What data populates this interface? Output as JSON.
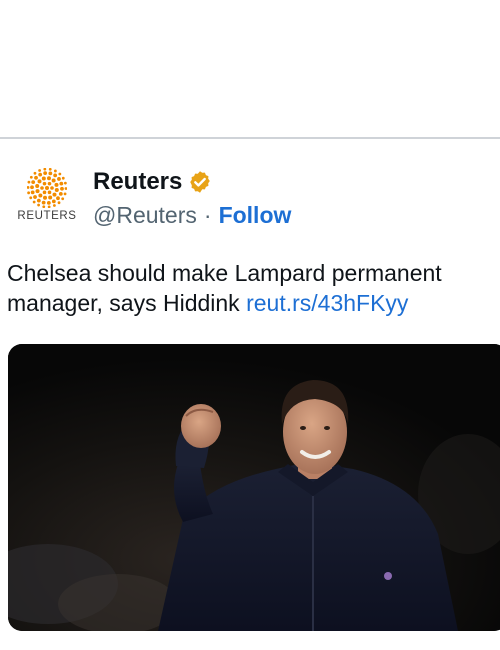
{
  "author": {
    "logo_wordmark": "REUTERS",
    "display_name": "Reuters",
    "handle": "@Reuters",
    "separator": "·",
    "follow_label": "Follow",
    "verified_badge_color": "#e8a317"
  },
  "tweet": {
    "text": "Chelsea should make Lampard permanent manager, says Hiddink",
    "link": "reut.rs/43hFKyy"
  },
  "media": {
    "description_icon": "photo-of-man-raising-fist"
  },
  "colors": {
    "link_blue": "#1d6fd4",
    "text_dark": "#0f1419",
    "reuters_orange": "#f28c00",
    "divider": "#cfd3d8"
  }
}
